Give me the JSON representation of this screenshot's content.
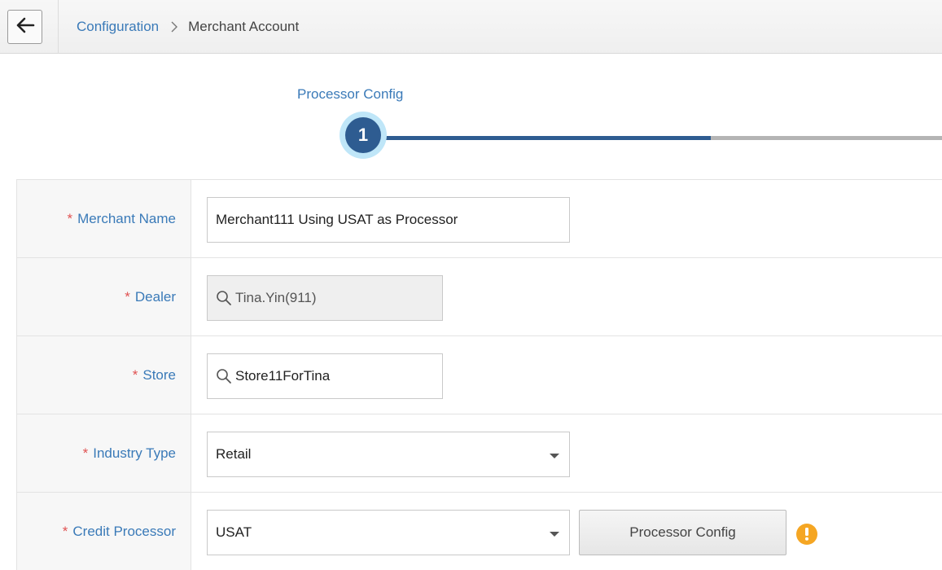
{
  "breadcrumb": {
    "parent": "Configuration",
    "current": "Merchant Account"
  },
  "stepper": {
    "steps": [
      {
        "number": "1",
        "label": "Processor Config",
        "active": true
      }
    ]
  },
  "form": {
    "required_mark": "*",
    "merchant_name": {
      "label": "Merchant Name",
      "value": "Merchant111 Using USAT as Processor"
    },
    "dealer": {
      "label": "Dealer",
      "value": "Tina.Yin(911)",
      "readonly": true
    },
    "store": {
      "label": "Store",
      "value": "Store11ForTina"
    },
    "industry_type": {
      "label": "Industry Type",
      "value": "Retail"
    },
    "credit_processor": {
      "label": "Credit Processor",
      "value": "USAT",
      "config_button": "Processor Config"
    }
  },
  "colors": {
    "accent": "#3a7ab8",
    "step_active": "#2e5c91",
    "step_halo": "#bfe6f8",
    "required": "#e05252",
    "warning": "#f5a623"
  },
  "icons": {
    "back": "arrow-left-icon",
    "crumb_separator": "chevron-right-icon",
    "search": "search-icon",
    "dropdown": "caret-down-icon",
    "warning": "warning-icon"
  }
}
